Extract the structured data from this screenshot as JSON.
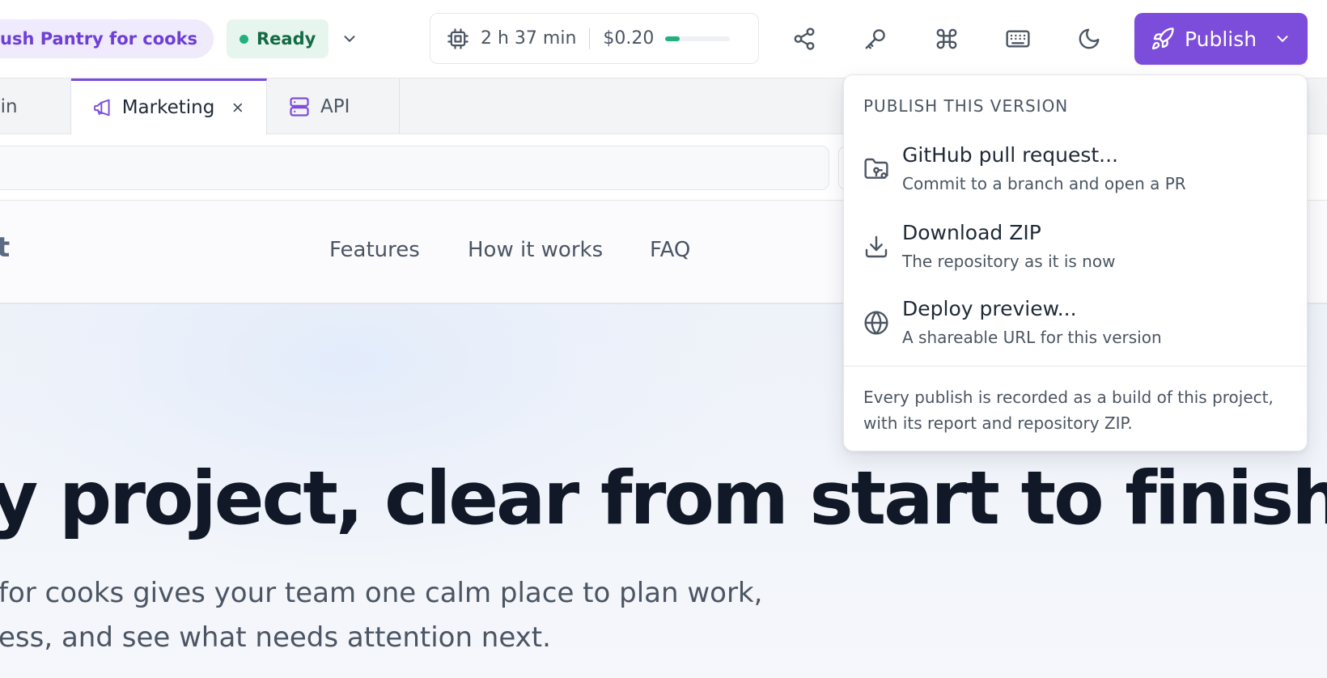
{
  "topbar": {
    "project_name": "ush Pantry for cooks",
    "status": {
      "label": "Ready",
      "color": "#22b07d"
    },
    "usage": {
      "time": "2 h 37 min",
      "cost": "$0.20",
      "progress_fraction": 0.22
    },
    "icons": [
      "cpu-icon",
      "share-icon",
      "key-icon",
      "command-icon",
      "keyboard-icon",
      "moon-icon",
      "rocket-icon"
    ],
    "publish_label": "Publish",
    "accent_color": "#7c4ddb"
  },
  "tabs": [
    {
      "label": "nin",
      "active": false
    },
    {
      "label": "Marketing",
      "active": true,
      "icon": "megaphone-icon"
    },
    {
      "label": "API",
      "active": false,
      "icon": "server-icon"
    }
  ],
  "preview": {
    "brand_tail": "t",
    "nav": [
      "Features",
      "How it works",
      "FAQ"
    ],
    "hero_title": "y project, clear from start to finish",
    "hero_sub_line1": "for cooks gives your team one calm place to plan work,",
    "hero_sub_line2": "ess, and see what needs attention next."
  },
  "publish_menu": {
    "heading": "PUBLISH THIS VERSION",
    "items": [
      {
        "title": "GitHub pull request...",
        "desc": "Commit to a branch and open a PR",
        "icon": "folder-git-icon"
      },
      {
        "title": "Download ZIP",
        "desc": "The repository as it is now",
        "icon": "download-icon"
      },
      {
        "title": "Deploy preview...",
        "desc": "A shareable URL for this version",
        "icon": "globe-icon"
      }
    ],
    "footnote": "Every publish is recorded as a build of this project, with its report and repository ZIP."
  }
}
